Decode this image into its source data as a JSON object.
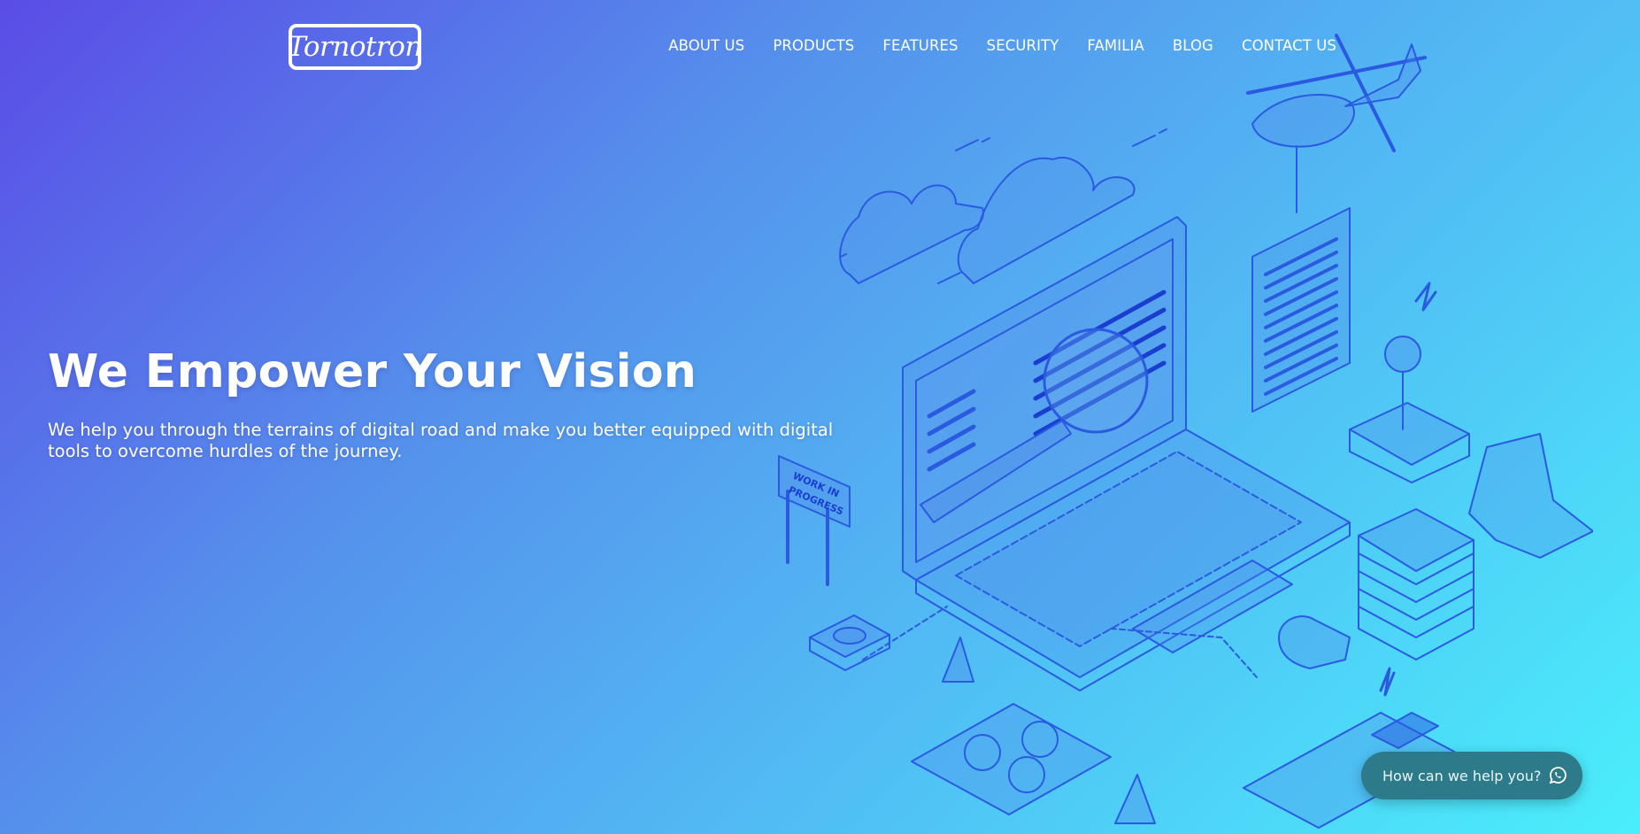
{
  "brand": {
    "logo_text": "Tornotron"
  },
  "nav": {
    "items": [
      {
        "label": "ABOUT US"
      },
      {
        "label": "PRODUCTS"
      },
      {
        "label": "FEATURES"
      },
      {
        "label": "SECURITY"
      },
      {
        "label": "FAMILIA"
      },
      {
        "label": "BLOG"
      },
      {
        "label": "CONTACT US"
      }
    ]
  },
  "hero": {
    "title": "We Empower Your Vision",
    "subtitle": "We help you through the terrains of digital road and make you better equipped with digital tools to overcome hurdles of the journey."
  },
  "illustration": {
    "sign_text_1": "WORK IN",
    "sign_text_2": "PROGRESS"
  },
  "help_widget": {
    "label": "How can we help you?",
    "icon": "whatsapp-icon"
  },
  "colors": {
    "gradient_start": "#5a4ce6",
    "gradient_end": "#4aeefb",
    "line": "#2a5ae0",
    "help_bg": "#2d7a8a"
  }
}
